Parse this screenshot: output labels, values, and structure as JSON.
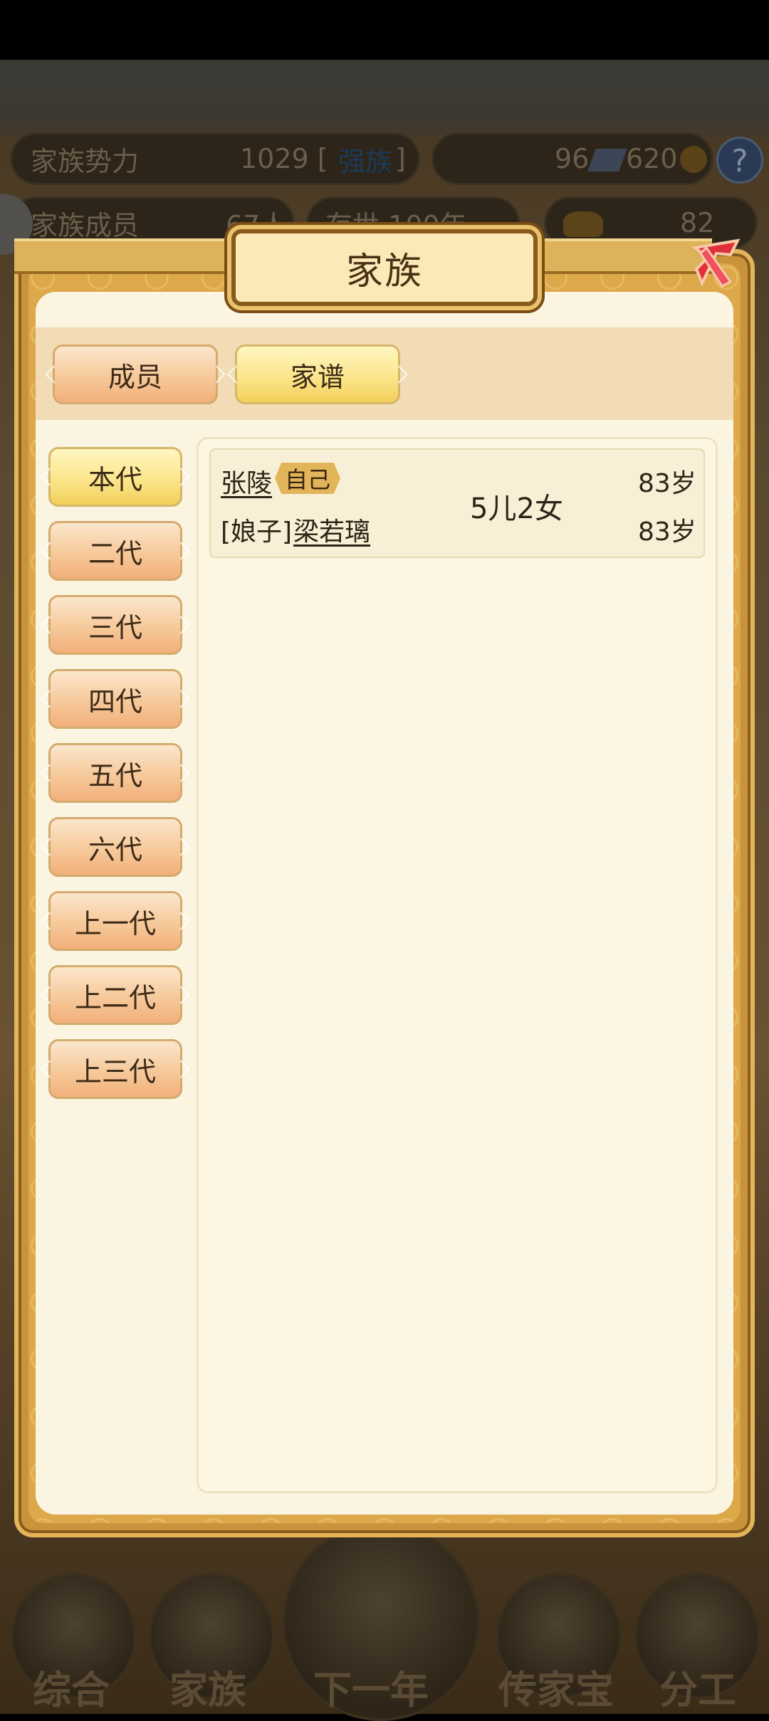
{
  "hud": {
    "power_label": "家族势力",
    "power_value": "1029 [",
    "power_rank": "强族",
    "power_close": "]",
    "currency_1": "96",
    "currency_2": "620",
    "members_label": "家族成员",
    "members_value": "67人",
    "age_label": "存世 100年",
    "gold_value": "82"
  },
  "dialog": {
    "title": "家族",
    "tabs": [
      {
        "label": "成员",
        "active": false
      },
      {
        "label": "家谱",
        "active": true
      }
    ],
    "generations": [
      {
        "label": "本代",
        "active": true
      },
      {
        "label": "二代",
        "active": false
      },
      {
        "label": "三代",
        "active": false
      },
      {
        "label": "四代",
        "active": false
      },
      {
        "label": "五代",
        "active": false
      },
      {
        "label": "六代",
        "active": false
      },
      {
        "label": "上一代",
        "active": false
      },
      {
        "label": "上二代",
        "active": false
      },
      {
        "label": "上三代",
        "active": false
      }
    ],
    "member": {
      "name": "张陵",
      "badge": "自己",
      "spouse_prefix": "[娘子]",
      "spouse_name": "梁若璃",
      "children": "5儿2女",
      "age": "83岁",
      "spouse_age": "83岁"
    }
  },
  "bottom_nav": [
    "综合",
    "家族",
    "下一年",
    "传家宝",
    "分工"
  ]
}
